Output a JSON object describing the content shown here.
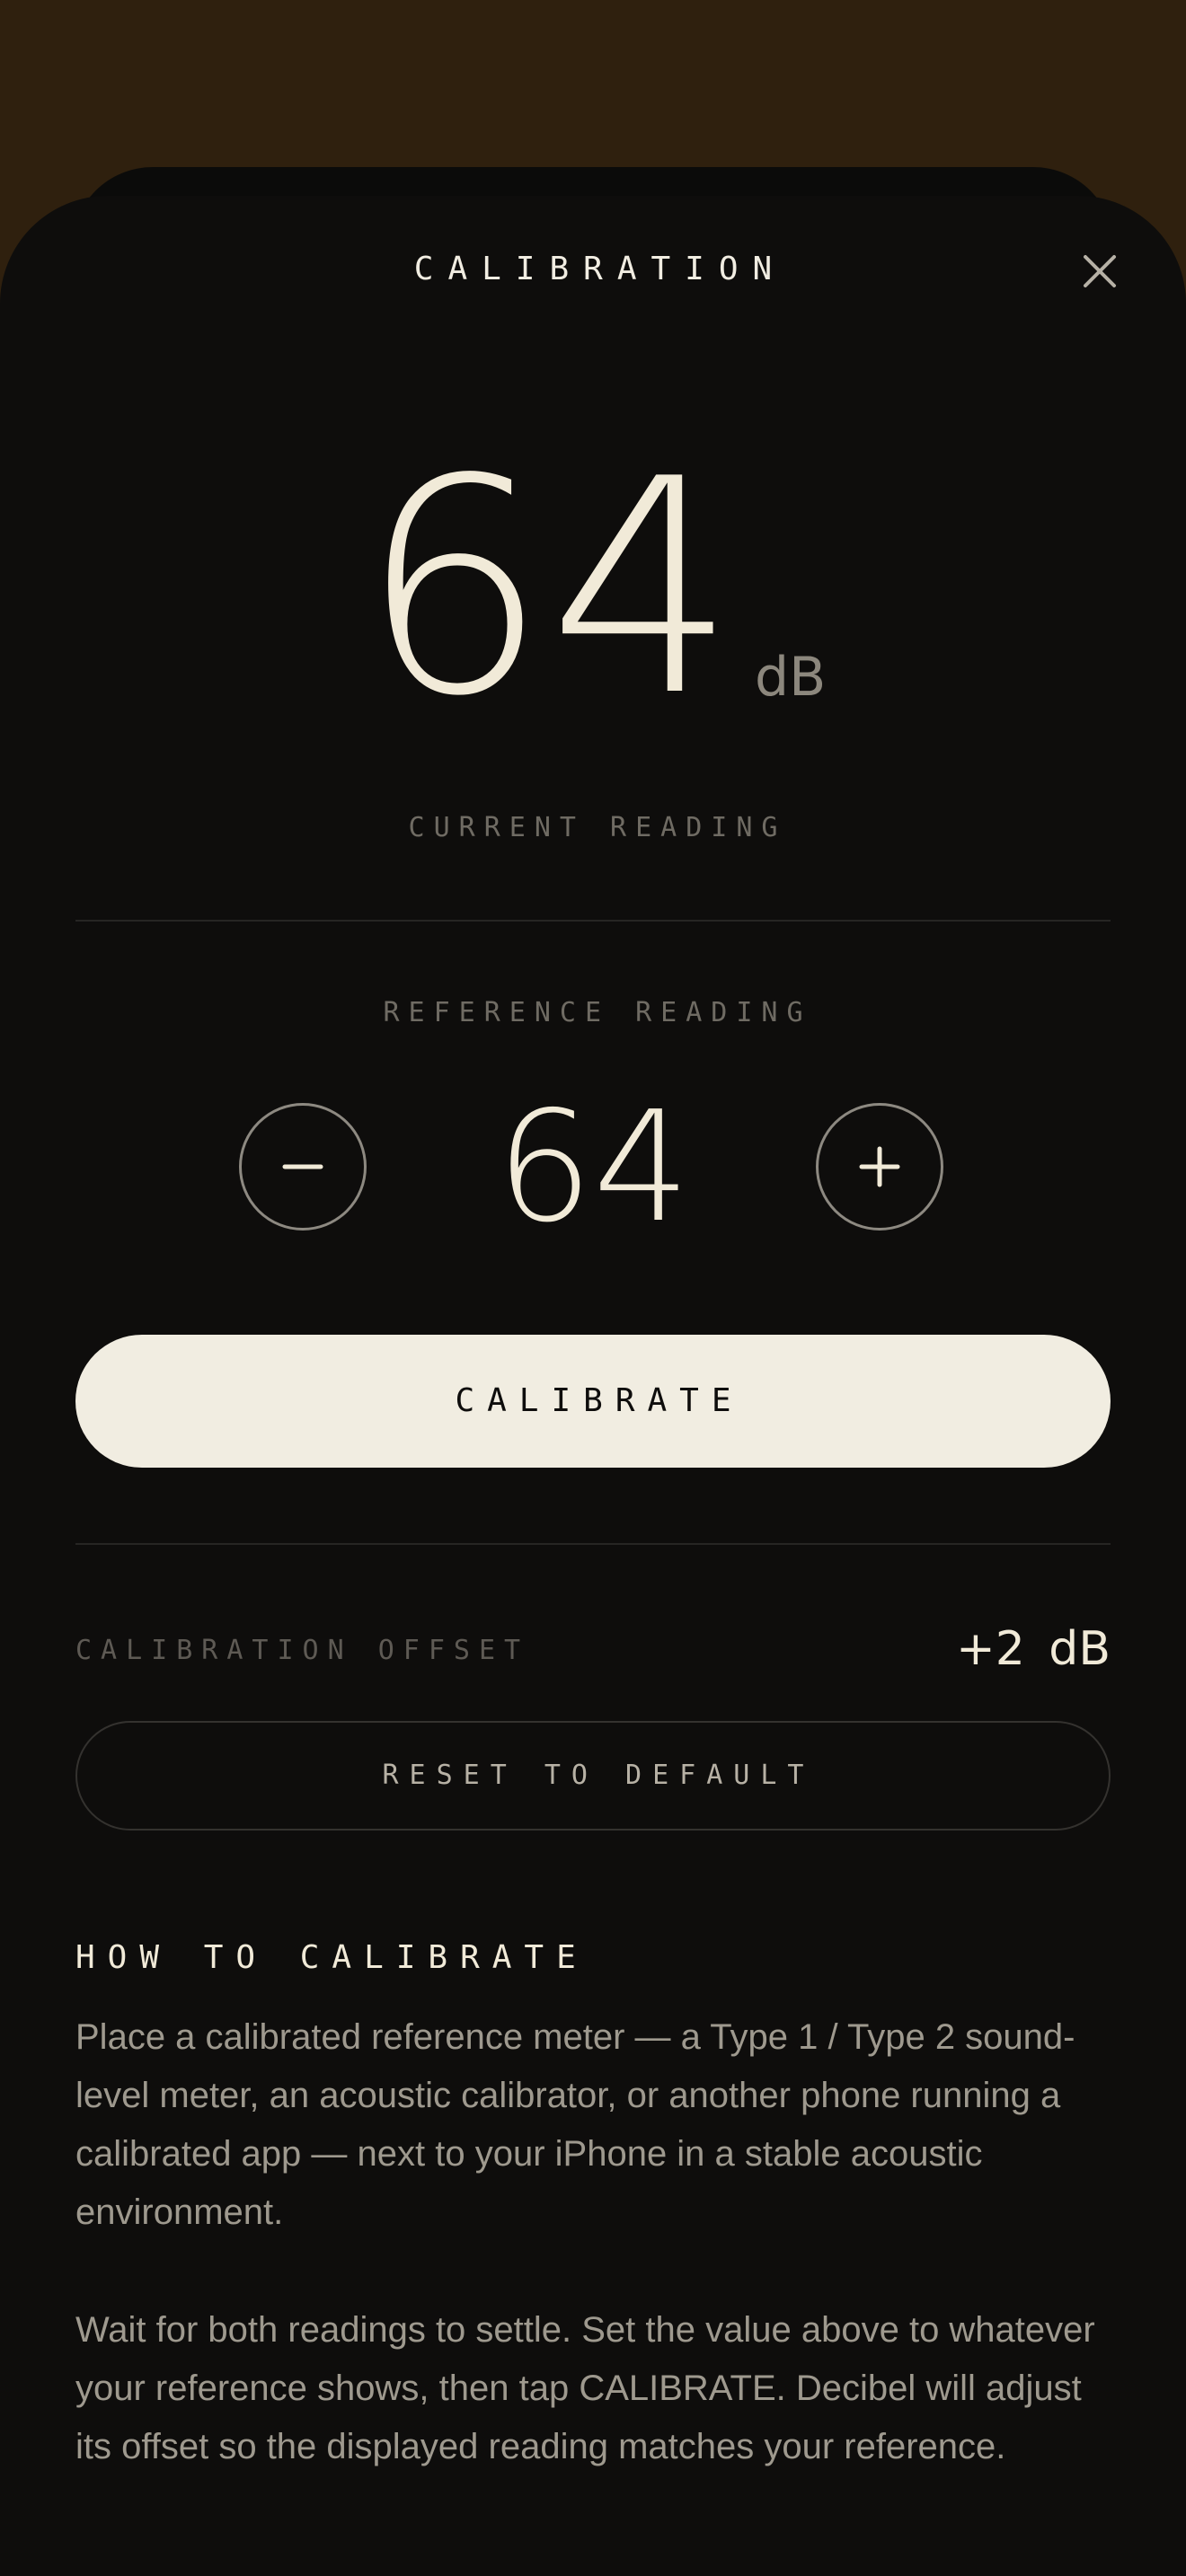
{
  "header": {
    "title": "CALIBRATION",
    "close_icon": "close-icon"
  },
  "current": {
    "value": "64",
    "unit": "dB",
    "caption": "CURRENT READING"
  },
  "reference": {
    "caption": "REFERENCE READING",
    "value": "64",
    "decrement_icon": "minus-icon",
    "increment_icon": "plus-icon"
  },
  "actions": {
    "calibrate_label": "CALIBRATE",
    "reset_label": "RESET TO DEFAULT"
  },
  "offset": {
    "label": "CALIBRATION OFFSET",
    "value": "+2 dB"
  },
  "howto": {
    "title": "HOW TO CALIBRATE",
    "paragraph1": "Place a calibrated reference meter — a Type 1 / Type 2 sound-level meter, an acoustic calibrator, or another phone running a calibrated app — next to your iPhone in a stable acoustic environment.",
    "paragraph2": "Wait for both readings to settle. Set the value above to whatever your reference shows, then tap CALIBRATE. Decibel will adjust its offset so the displayed reading matches your reference."
  },
  "colors": {
    "backdrop": "#2f200e",
    "sheet": "#0e0d0c",
    "cream": "#f1ede1",
    "muted": "#6f6b63"
  }
}
